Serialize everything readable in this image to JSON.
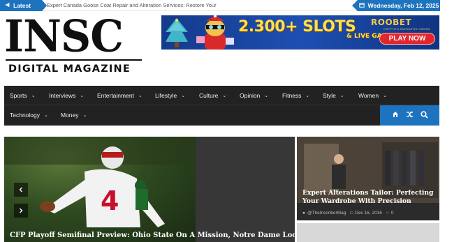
{
  "topbar": {
    "latest_label": "Latest",
    "ticker_text": "Expert Canada Goose Coat Repair and Alteration Services: Restore Your",
    "date_text": "Wednesday, Feb 12, 2025"
  },
  "logo": {
    "main": "INSC",
    "sub": "DIGITAL MAGAZINE"
  },
  "banner": {
    "promo": "2.300+ SLOTS",
    "sub": "& LIVE GAMES",
    "brand": "ROOBET",
    "brand_sub": "CRYPTO'S FAVOURITE CASINO",
    "cta": "PLAY NOW"
  },
  "nav": {
    "row1": [
      "Sports",
      "Interviews",
      "Entertainment",
      "Lifestyle",
      "Culture",
      "Opinion",
      "Fitness",
      "Style",
      "Women"
    ],
    "row2": [
      "Technology",
      "Money"
    ]
  },
  "hero": {
    "caption": "CFP Playoff Semifinal Preview: Ohio State On A Mission, Notre Dame Looking"
  },
  "side": {
    "title": "Expert Alterations Tailor: Perfecting Your Wardrobe With Precision",
    "author": "@TheInscriberMag",
    "date": "Dec 16, 2016",
    "comments": "0"
  },
  "colors": {
    "accent": "#1e73be",
    "nav_bg": "#222222"
  }
}
